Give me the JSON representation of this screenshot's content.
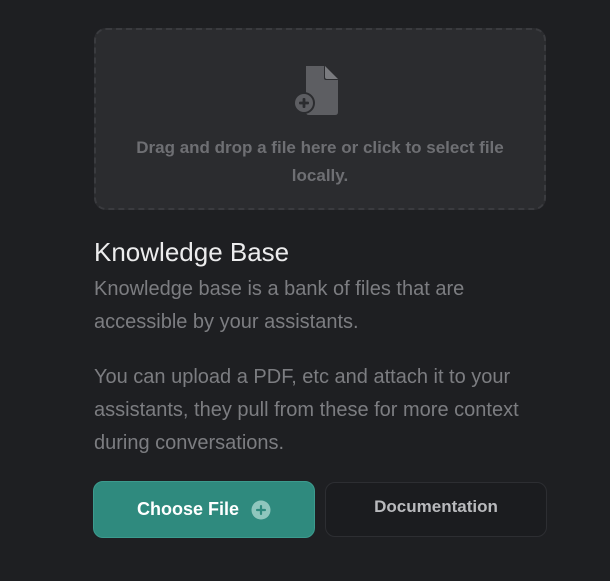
{
  "dropzone": {
    "icon": "file-plus-icon",
    "text": "Drag and drop a file here or click to select file locally."
  },
  "knowledge_base": {
    "title": "Knowledge Base",
    "description": "Knowledge base is a bank of files that are accessible by your assistants.",
    "details": "You can upload a PDF, etc and attach it to your assistants, they pull from these for more context during conversations."
  },
  "actions": {
    "choose_file_label": "Choose File",
    "choose_file_icon": "plus-circle-icon",
    "documentation_label": "Documentation"
  },
  "colors": {
    "background": "#1e1f22",
    "dropzone": "#2b2c2f",
    "accent": "#2f8a7e",
    "muted_text": "#7c7d81"
  }
}
